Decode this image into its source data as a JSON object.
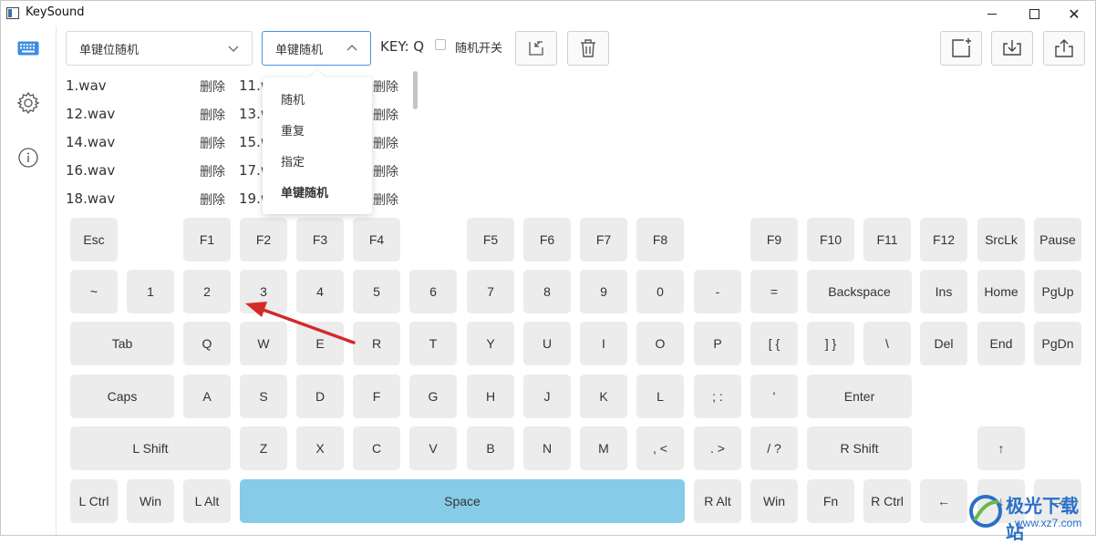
{
  "window": {
    "title": "KeySound",
    "controls": {
      "minimize": "minimize",
      "maximize": "maximize",
      "close": "✕"
    }
  },
  "rail": {
    "items": [
      "keyboard-icon",
      "gear-icon",
      "info-icon"
    ]
  },
  "toolbar": {
    "mode_select": "单键位随机",
    "play_select": "单键随机",
    "key_label": "KEY: Q",
    "random_switch_label": "随机开关",
    "random_switch_checked": false
  },
  "files": [
    {
      "left": "1.wav",
      "left_del": "删除",
      "right": "11.wav",
      "right_del": "删除"
    },
    {
      "left": "12.wav",
      "left_del": "删除",
      "right": "13.wav",
      "right_del": "删除"
    },
    {
      "left": "14.wav",
      "left_del": "删除",
      "right": "15.wav",
      "right_del": "删除"
    },
    {
      "left": "16.wav",
      "left_del": "删除",
      "right": "17.wav",
      "right_del": "删除"
    },
    {
      "left": "18.wav",
      "left_del": "删除",
      "right": "19.wav",
      "right_del": "删除"
    }
  ],
  "dropdown": {
    "options": [
      "随机",
      "重复",
      "指定",
      "单键随机"
    ],
    "selected": "单键随机"
  },
  "keyboard": {
    "row1": [
      "Esc",
      "F1",
      "F2",
      "F3",
      "F4",
      "F5",
      "F6",
      "F7",
      "F8",
      "F9",
      "F10",
      "F11",
      "F12",
      "SrcLk",
      "Pause"
    ],
    "row2": [
      "~",
      "1",
      "2",
      "3",
      "4",
      "5",
      "6",
      "7",
      "8",
      "9",
      "0",
      "-",
      "=",
      "Backspace",
      "Ins",
      "Home",
      "PgUp"
    ],
    "row3": [
      "Tab",
      "Q",
      "W",
      "E",
      "R",
      "T",
      "Y",
      "U",
      "I",
      "O",
      "P",
      "[ {",
      "] }",
      "\\",
      "Del",
      "End",
      "PgDn"
    ],
    "row4": [
      "Caps",
      "A",
      "S",
      "D",
      "F",
      "G",
      "H",
      "J",
      "K",
      "L",
      "; :",
      "'",
      "Enter"
    ],
    "row5": [
      "L Shift",
      "Z",
      "X",
      "C",
      "V",
      "B",
      "N",
      "M",
      ", <",
      ". >",
      "/ ?",
      "R Shift",
      "↑"
    ],
    "row6": [
      "L Ctrl",
      "Win",
      "L Alt",
      "Space",
      "R Alt",
      "Win",
      "Fn",
      "R Ctrl",
      "←",
      "↓",
      "→"
    ]
  },
  "colors": {
    "space_key": "#86cbe8",
    "key": "#ececec",
    "arrow": "#d42a2a",
    "watermark": "#2b6fc7"
  },
  "watermark": {
    "main": "极光下载站",
    "sub": "www.xz7.com"
  }
}
